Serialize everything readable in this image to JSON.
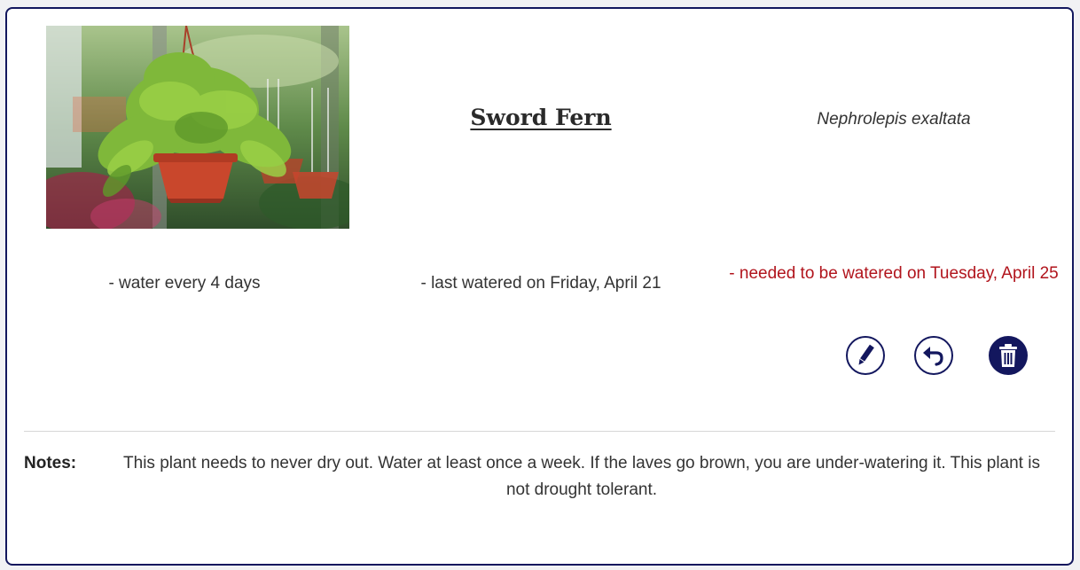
{
  "plant": {
    "common_name": "Sword Fern",
    "scientific_name": "Nephrolepis exaltata",
    "watering_frequency": "- water every 4 days",
    "last_watered": "- last watered on Friday, April 21",
    "next_watering": "- needed to be watered on Tuesday, April 25",
    "photo_icon": "hanging-fern-photo"
  },
  "actions": {
    "edit_icon": "pencil-icon",
    "undo_icon": "undo-arrow-icon",
    "delete_icon": "trash-icon"
  },
  "notes": {
    "label": "Notes:",
    "text": "This plant needs to never dry out. Water at least once a week. If the laves go brown, you are under-watering it. This plant is not drought tolerant."
  },
  "colors": {
    "accent": "#13175e",
    "overdue": "#b1141c",
    "text": "#333333"
  }
}
